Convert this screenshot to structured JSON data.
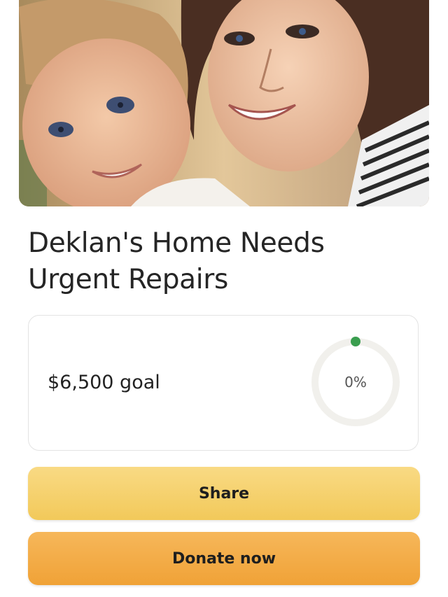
{
  "campaign": {
    "title": "Deklan's Home Needs Urgent Repairs",
    "goal_text": "$6,500 goal",
    "progress_fraction": 0,
    "progress_label": "0%"
  },
  "actions": {
    "share_label": "Share",
    "donate_label": "Donate now"
  },
  "colors": {
    "progress_dot": "#3a9e4f",
    "progress_track": "#f1f0ec",
    "share_button": "#f5d06f",
    "donate_button": "#f3ad47"
  }
}
